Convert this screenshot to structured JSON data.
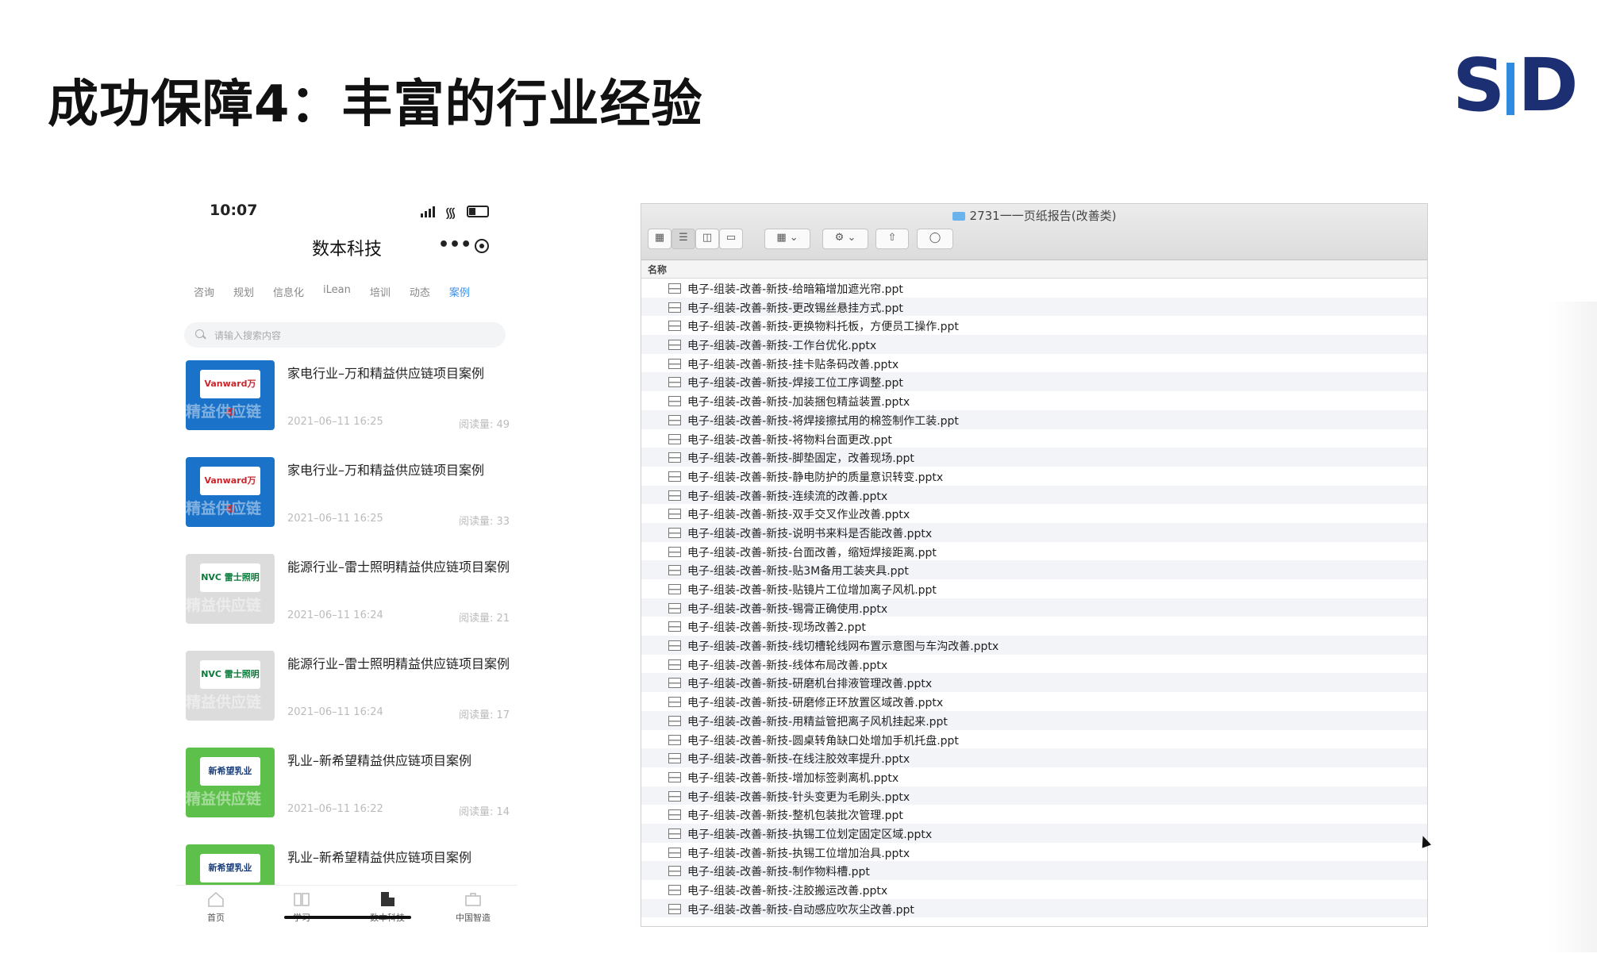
{
  "slide": {
    "title": "成功保障4：丰富的行业经验",
    "logo_text": "STD",
    "brand_color": "#1d2f73"
  },
  "phone": {
    "time": "10:07",
    "app_title": "数本科技",
    "tabs": [
      "咨询",
      "规划",
      "信息化",
      "iLean",
      "培训",
      "动态",
      "案例"
    ],
    "active_tab": "案例",
    "search_placeholder": "请输入搜索内容",
    "cards": [
      {
        "title": "家电行业–万和精益供应链项目案例",
        "date": "2021–06–11 16:25",
        "reads": "阅读量: 49",
        "logo": "Vanward万和",
        "watermark": "精益供应链"
      },
      {
        "title": "家电行业–万和精益供应链项目案例",
        "date": "2021–06–11 16:25",
        "reads": "阅读量: 33",
        "logo": "Vanward万和",
        "watermark": "精益供应链"
      },
      {
        "title": "能源行业–雷士照明精益供应链项目案例",
        "date": "2021–06–11 16:24",
        "reads": "阅读量: 21",
        "logo": "NVC 雷士照明",
        "watermark": "精益供应链"
      },
      {
        "title": "能源行业–雷士照明精益供应链项目案例",
        "date": "2021–06–11 16:24",
        "reads": "阅读量: 17",
        "logo": "NVC 雷士照明",
        "watermark": "精益供应链"
      },
      {
        "title": "乳业–新希望精益供应链项目案例",
        "date": "2021–06–11 16:22",
        "reads": "阅读量: 14",
        "logo": "新希望乳业",
        "watermark": "精益供应链"
      },
      {
        "title": "乳业–新希望精益供应链项目案例",
        "date": "",
        "reads": "",
        "logo": "新希望乳业",
        "watermark": ""
      }
    ],
    "tabbar": [
      "首页",
      "学习",
      "数本科技",
      "中国智造"
    ]
  },
  "finder": {
    "window_title": "2731一一页纸报告(改善类)",
    "column_name": "名称",
    "files": [
      "电子-组装-改善-新技-给暗箱增加遮光帘.ppt",
      "电子-组装-改善-新技-更改锡丝悬挂方式.ppt",
      "电子-组装-改善-新技-更换物料托板，方便员工操作.ppt",
      "电子-组装-改善-新技-工作台优化.pptx",
      "电子-组装-改善-新技-挂卡贴条码改善.pptx",
      "电子-组装-改善-新技-焊接工位工序调整.ppt",
      "电子-组装-改善-新技-加装捆包精益装置.pptx",
      "电子-组装-改善-新技-将焊接擦拭用的棉签制作工装.ppt",
      "电子-组装-改善-新技-将物料台面更改.ppt",
      "电子-组装-改善-新技-脚垫固定，改善现场.ppt",
      "电子-组装-改善-新技-静电防护的质量意识转变.pptx",
      "电子-组装-改善-新技-连续流的改善.pptx",
      "电子-组装-改善-新技-双手交叉作业改善.pptx",
      "电子-组装-改善-新技-说明书来料是否能改善.pptx",
      "电子-组装-改善-新技-台面改善，缩短焊接距离.ppt",
      "电子-组装-改善-新技-贴3M备用工装夹具.ppt",
      "电子-组装-改善-新技-贴镜片工位增加离子风机.ppt",
      "电子-组装-改善-新技-锡膏正确使用.pptx",
      "电子-组装-改善-新技-现场改善2.ppt",
      "电子-组装-改善-新技-线切槽轮线网布置示意图与车沟改善.pptx",
      "电子-组装-改善-新技-线体布局改善.pptx",
      "电子-组装-改善-新技-研磨机台排液管理改善.pptx",
      "电子-组装-改善-新技-研磨修正环放置区域改善.pptx",
      "电子-组装-改善-新技-用精益管把离子风机挂起来.ppt",
      "电子-组装-改善-新技-圆桌转角缺口处增加手机托盘.ppt",
      "电子-组装-改善-新技-在线注胶效率提升.pptx",
      "电子-组装-改善-新技-增加标签剥离机.pptx",
      "电子-组装-改善-新技-针头变更为毛刷头.pptx",
      "电子-组装-改善-新技-整机包装批次管理.ppt",
      "电子-组装-改善-新技-执锡工位划定固定区域.pptx",
      "电子-组装-改善-新技-执锡工位增加治具.pptx",
      "电子-组装-改善-新技-制作物料槽.ppt",
      "电子-组装-改善-新技-注胶搬运改善.pptx",
      "电子-组装-改善-新技-自动感应吹灰尘改善.ppt"
    ]
  }
}
